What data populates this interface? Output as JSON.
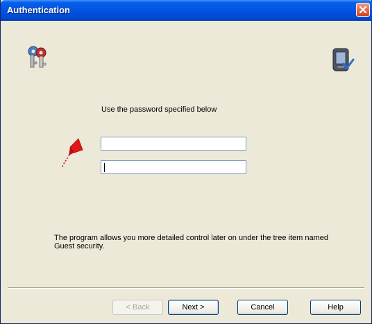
{
  "window": {
    "title": "Authentication"
  },
  "icons": {
    "left": "keys-icon",
    "right": "pda-check-icon",
    "flag": "kite-icon",
    "close": "close-icon"
  },
  "main": {
    "prompt": "Use the password specified below",
    "password_field_1": {
      "value": "",
      "placeholder": ""
    },
    "password_field_2": {
      "value": "",
      "placeholder": ""
    },
    "info": "The program allows you more detailed control later on under the tree item named Guest security."
  },
  "buttons": {
    "back": "< Back",
    "next": "Next >",
    "cancel": "Cancel",
    "help": "Help"
  },
  "colors": {
    "titlebar": "#0055e3",
    "dialog_bg": "#ece9d8",
    "close_button": "#d2411b",
    "flag": "#e01818"
  }
}
